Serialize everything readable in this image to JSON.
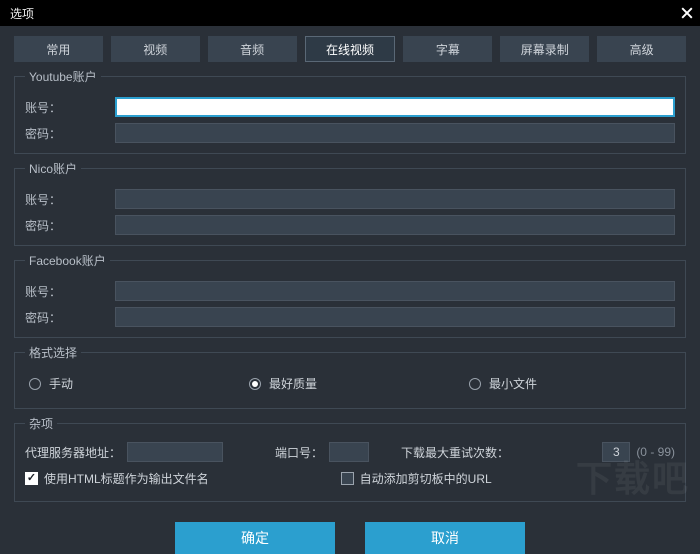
{
  "title": "选项",
  "tabs": [
    "常用",
    "视频",
    "音频",
    "在线视频",
    "字幕",
    "屏幕录制",
    "高级"
  ],
  "activeTab": 3,
  "groups": {
    "youtube": {
      "legend": "Youtube账户",
      "userLabel": "账号：",
      "passLabel": "密码：",
      "user": "",
      "pass": ""
    },
    "nico": {
      "legend": "Nico账户",
      "userLabel": "账号：",
      "passLabel": "密码：",
      "user": "",
      "pass": ""
    },
    "facebook": {
      "legend": "Facebook账户",
      "userLabel": "账号：",
      "passLabel": "密码：",
      "user": "",
      "pass": ""
    }
  },
  "format": {
    "legend": "格式选择",
    "options": [
      "手动",
      "最好质量",
      "最小文件"
    ],
    "selected": 1
  },
  "misc": {
    "legend": "杂项",
    "proxyLabel": "代理服务器地址：",
    "proxy": "",
    "portLabel": "端口号：",
    "port": "",
    "retryLabel": "下载最大重试次数：",
    "retry": "3",
    "retryRange": "(0 - 99)",
    "useHtmlTitle": {
      "checked": true,
      "label": "使用HTML标题作为输出文件名"
    },
    "autoClipboard": {
      "checked": false,
      "label": "自动添加剪切板中的URL"
    }
  },
  "buttons": {
    "ok": "确定",
    "cancel": "取消"
  },
  "watermark": "下载吧"
}
